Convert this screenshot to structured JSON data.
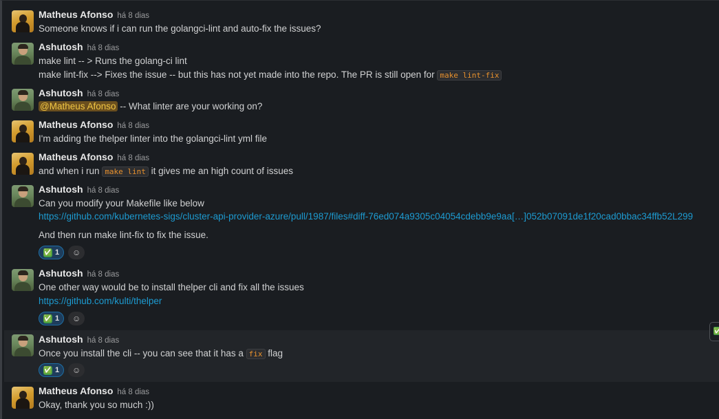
{
  "messages": [
    {
      "author": "Matheus Afonso",
      "time": "há 8 dias",
      "lines": [
        "Someone knows if i can run the golangci-lint and auto-fix the issues?"
      ]
    },
    {
      "author": "Ashutosh",
      "time": "há 8 dias",
      "line1": "make lint -- > Runs the golang-ci lint",
      "line2_text": "make lint-fix --> Fixes the issue -- but this has not yet made into the repo. The PR is still open for ",
      "line2_code": "make lint-fix"
    },
    {
      "author": "Ashutosh",
      "time": "há 8 dias",
      "mention": "@Matheus Afonso",
      "text": " -- What linter are your working on?"
    },
    {
      "author": "Matheus Afonso",
      "time": "há 8 dias",
      "text": "I'm adding the thelper linter into the golangci-lint yml file"
    },
    {
      "author": "Matheus Afonso",
      "time": "há 8 dias",
      "text_before": "and when i run ",
      "code": "make lint",
      "text_after": " it gives me an high count of issues"
    },
    {
      "author": "Ashutosh",
      "time": "há 8 dias",
      "line1": "Can you modify your Makefile like below",
      "link": "https://github.com/kubernetes-sigs/cluster-api-provider-azure/pull/1987/files#diff-76ed074a9305c04054cdebb9e9aa[…]052b07091de1f20cad0bbac34ffb52L299",
      "line3": "And then run make lint-fix to fix the issue.",
      "reaction_count": "1"
    },
    {
      "author": "Ashutosh",
      "time": "há 8 dias",
      "line1": "One other way would be to install thelper cli and fix all the issues",
      "link": "https://github.com/kulti/thelper",
      "reaction_count": "1"
    },
    {
      "author": "Ashutosh",
      "time": "há 8 dias",
      "text_before": "Once you install the cli -- you can see that it has a ",
      "code": "fix",
      "text_after": " flag",
      "reaction_count": "1"
    },
    {
      "author": "Matheus Afonso",
      "time": "há 8 dias",
      "text": "Okay, thank you so much :))"
    }
  ],
  "reaction_emoji": "✅",
  "add_reaction_icon": "add-reaction-icon"
}
